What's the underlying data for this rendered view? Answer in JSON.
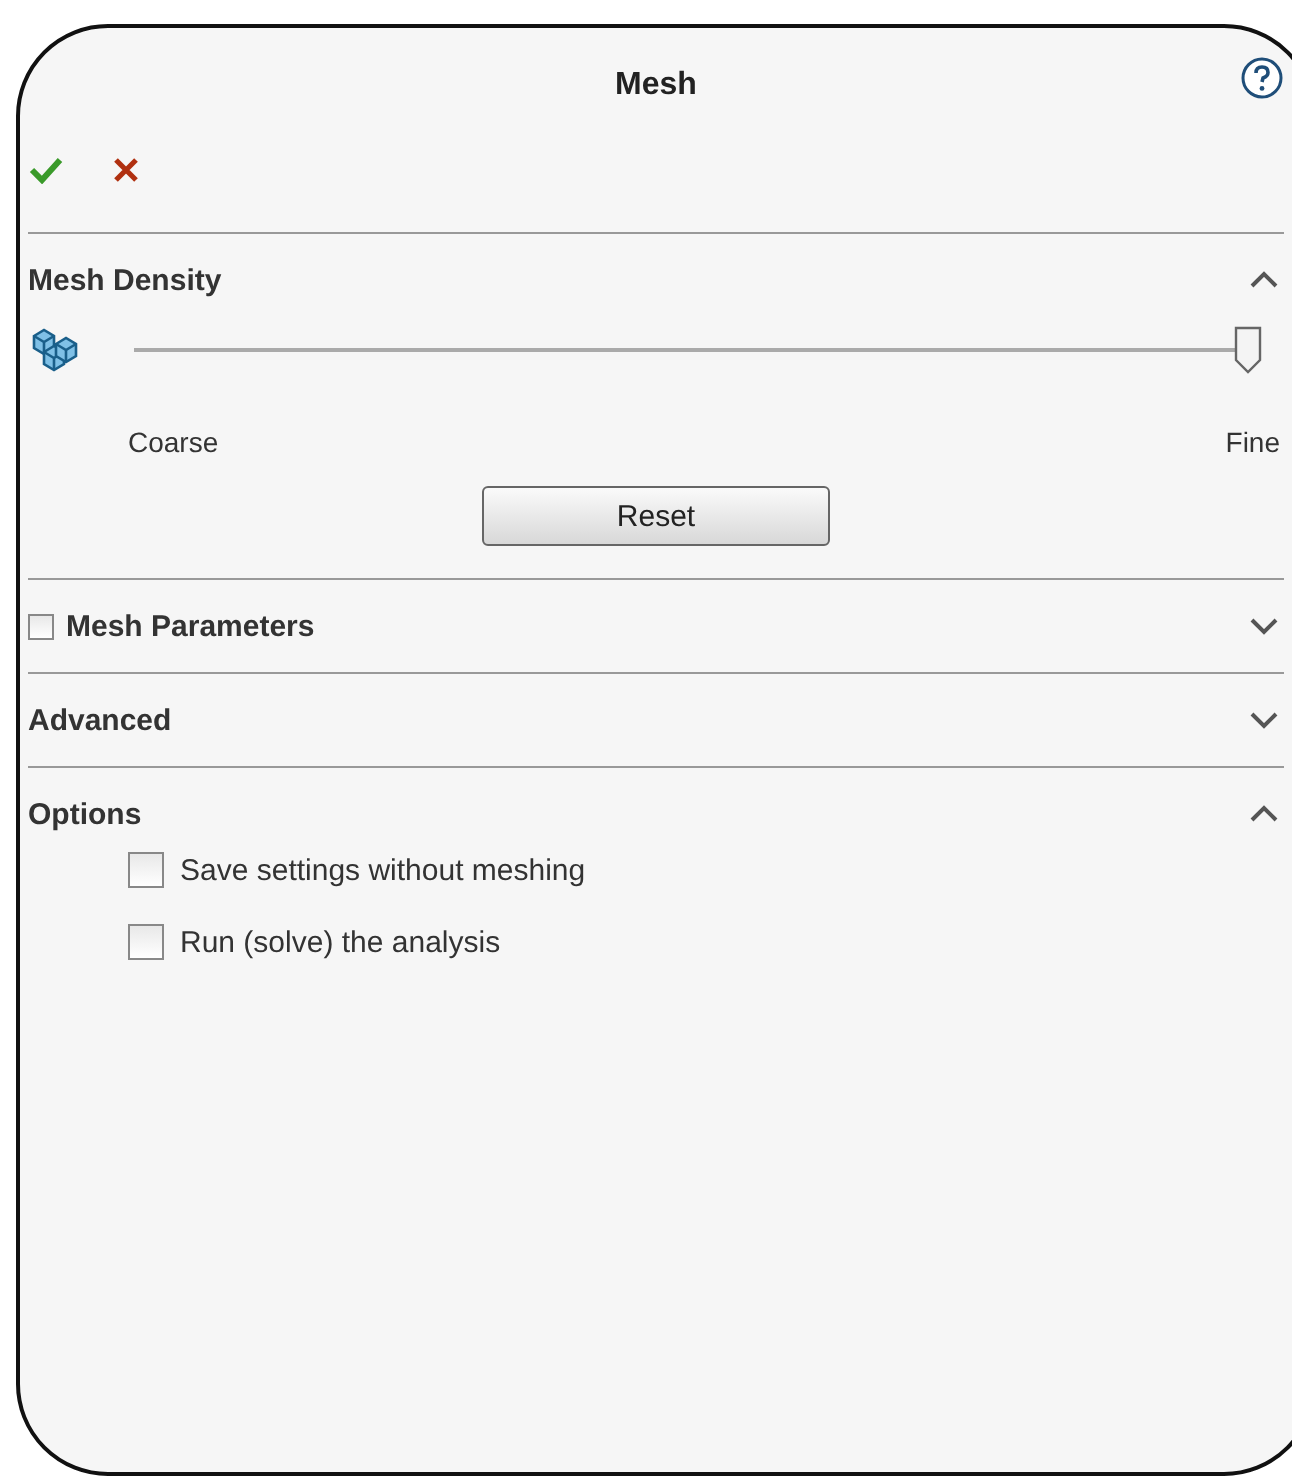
{
  "panel": {
    "title": "Mesh"
  },
  "sections": [
    {
      "kind": "density",
      "title": "Mesh Density",
      "expanded": true,
      "slider": {
        "level": 1.0
      },
      "min_label": "Coarse",
      "max_label": "Fine",
      "button": "Reset"
    },
    {
      "kind": "plain",
      "title": "Mesh Parameters",
      "expanded": false,
      "checked": false
    },
    {
      "kind": "plain",
      "title": "Advanced",
      "expanded": false
    },
    {
      "kind": "options",
      "title": "Options",
      "expanded": true,
      "options": [
        {
          "label": "Save settings without meshing",
          "checked": false
        },
        {
          "label": "Run (solve) the analysis",
          "checked": false
        }
      ]
    }
  ]
}
